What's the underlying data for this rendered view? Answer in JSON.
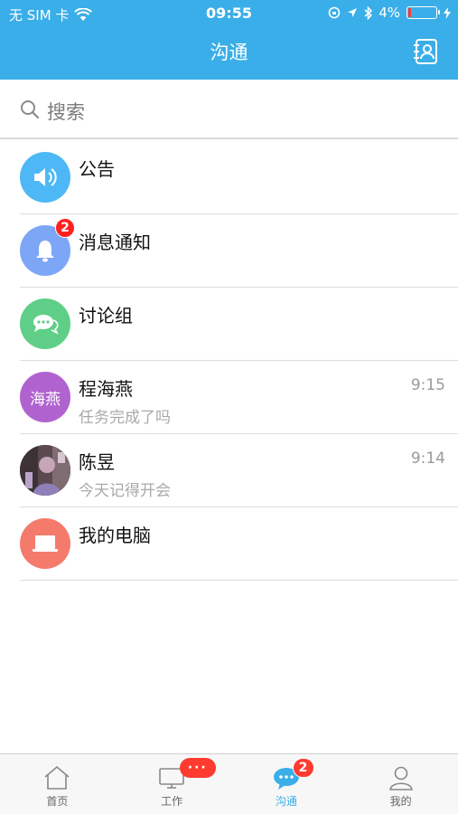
{
  "status_bar": {
    "carrier": "无 SIM 卡",
    "time": "09:55",
    "battery": "4%"
  },
  "header": {
    "title": "沟通"
  },
  "search": {
    "placeholder": "搜索"
  },
  "conversations": [
    {
      "title": "公告",
      "subtitle": "",
      "time": "",
      "badge": "",
      "avatar_color": "#4db8f5",
      "icon": "speaker-icon"
    },
    {
      "title": "消息通知",
      "subtitle": "",
      "time": "",
      "badge": "2",
      "avatar_color": "#7ea6f7",
      "icon": "bell-icon"
    },
    {
      "title": "讨论组",
      "subtitle": "",
      "time": "",
      "badge": "",
      "avatar_color": "#5fcf87",
      "icon": "chat-bubbles-icon"
    },
    {
      "title": "程海燕",
      "subtitle": "任务完成了吗",
      "time": "9:15",
      "badge": "",
      "avatar_color": "#b063cf",
      "avatar_text": "海燕"
    },
    {
      "title": "陈昱",
      "subtitle": "今天记得开会",
      "time": "9:14",
      "badge": "",
      "avatar_color": "#6b5a62",
      "icon": "user-photo"
    },
    {
      "title": "我的电脑",
      "subtitle": "",
      "time": "",
      "badge": "",
      "avatar_color": "#f47a6c",
      "icon": "laptop-icon"
    }
  ],
  "tabs": [
    {
      "label": "首页",
      "icon": "home-icon",
      "badge": "",
      "active": false
    },
    {
      "label": "工作",
      "icon": "monitor-icon",
      "badge": "···",
      "active": false
    },
    {
      "label": "沟通",
      "icon": "chat-icon",
      "badge": "2",
      "active": true
    },
    {
      "label": "我的",
      "icon": "person-icon",
      "badge": "",
      "active": false
    }
  ],
  "colors": {
    "accent": "#3aaee8",
    "badge": "#ff2020",
    "background": "#ffffff"
  }
}
